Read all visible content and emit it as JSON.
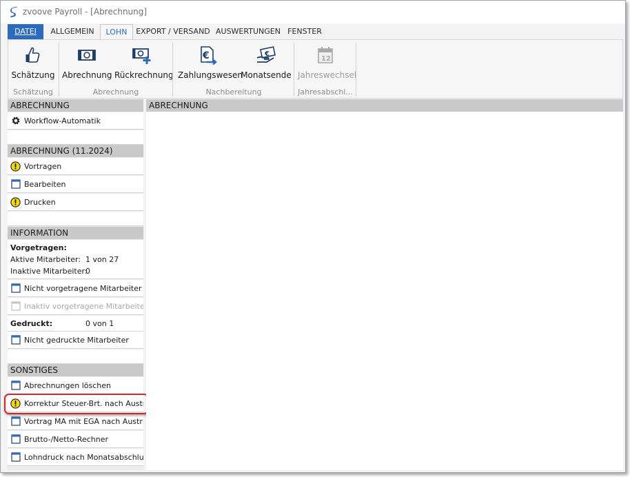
{
  "window": {
    "title": "zvoove Payroll - [Abrechnung]",
    "accent_color": "#2b6cc1"
  },
  "menu_tabs": [
    {
      "label": "DATEI",
      "active": false
    },
    {
      "label": "ALLGEMEIN",
      "active": false
    },
    {
      "label": "LOHN",
      "active": true
    },
    {
      "label": "EXPORT / VERSAND",
      "active": false
    },
    {
      "label": "AUSWERTUNGEN",
      "active": false
    },
    {
      "label": "FENSTER",
      "active": false
    }
  ],
  "ribbon": {
    "buttons": [
      {
        "label": "Schätzung",
        "icon": "thumbs-up-icon",
        "enabled": true
      },
      {
        "label": "Abrechnung",
        "icon": "banknote-icon",
        "enabled": true
      },
      {
        "label": "Rückrechnung",
        "icon": "banknote-plus-icon",
        "enabled": true
      },
      {
        "label": "Zahlungswesen",
        "icon": "euro-transfer-icon",
        "enabled": true
      },
      {
        "label": "Monatsende",
        "icon": "money-hand-icon",
        "enabled": true
      },
      {
        "label": "Jahreswechsel",
        "icon": "calendar-icon",
        "enabled": false
      }
    ],
    "groups": [
      "Schätzung",
      "Abrechnung",
      "Nachbereitung",
      "Jahresabschl..."
    ]
  },
  "left_panel": {
    "section_abrechnung": {
      "header": "ABRECHNUNG",
      "items": [
        {
          "label": "Workflow-Automatik",
          "icon": "gear-icon"
        }
      ]
    },
    "section_period": {
      "header": "ABRECHNUNG (11.2024)",
      "items": [
        {
          "label": "Vortragen",
          "icon": "warning-icon"
        },
        {
          "label": "Bearbeiten",
          "icon": "window-icon"
        },
        {
          "label": "Drucken",
          "icon": "warning-icon"
        }
      ]
    },
    "section_info": {
      "header": "INFORMATION",
      "vorgetragen_label": "Vorgetragen:",
      "aktive_label": "Aktive Mitarbeiter:",
      "aktive_value": "1 von 27",
      "inaktive_label": "Inaktive Mitarbeiter:",
      "inaktive_value": "0",
      "nicht_vorgetragen": "Nicht vorgetragene Mitarbeiter",
      "inaktiv_vorgetragen": "Inaktiv vorgetragene Mitarbeiter",
      "gedruckt_label": "Gedruckt:",
      "gedruckt_value": "0 von 1",
      "nicht_gedruckt": "Nicht gedruckte Mitarbeiter"
    },
    "section_sonstiges": {
      "header": "SONSTIGES",
      "items": [
        {
          "label": "Abrechnungen löschen",
          "icon": "window-icon"
        },
        {
          "label": "Korrektur Steuer-Brt. nach Austritt",
          "icon": "warning-icon"
        },
        {
          "label": "Vortrag MA mit EGA nach Austritt",
          "icon": "window-icon"
        },
        {
          "label": "Brutto-/Netto-Rechner",
          "icon": "window-icon"
        },
        {
          "label": "Lohndruck nach Monatsabschluss",
          "icon": "window-icon"
        }
      ]
    }
  },
  "content": {
    "header": "ABRECHNUNG"
  }
}
